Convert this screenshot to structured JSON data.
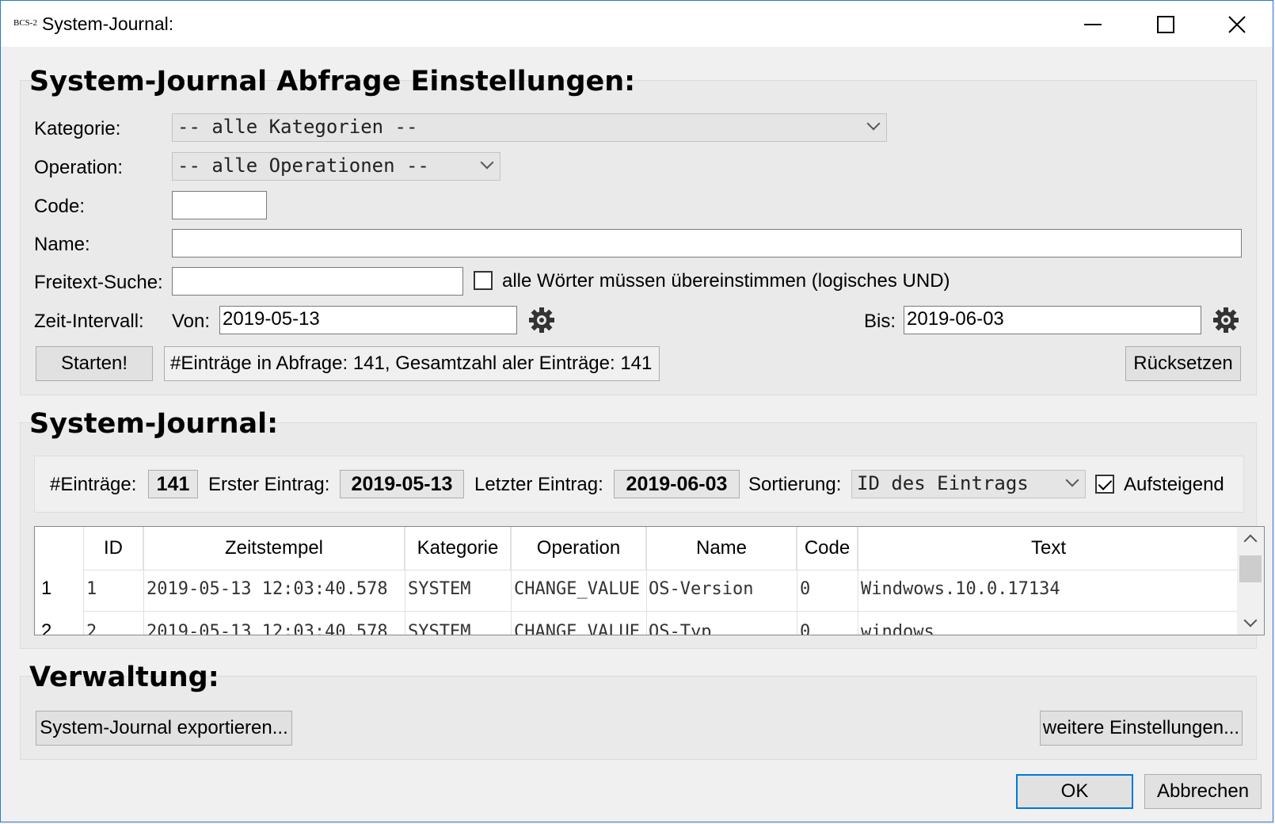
{
  "window": {
    "logo": "BCS-2",
    "title": "System-Journal:"
  },
  "query": {
    "title": "System-Journal Abfrage Einstellungen:",
    "category_label": "Kategorie:",
    "category_value": "-- alle Kategorien --",
    "operation_label": "Operation:",
    "operation_value": "-- alle Operationen --",
    "code_label": "Code:",
    "code_value": "",
    "name_label": "Name:",
    "name_value": "",
    "search_label": "Freitext-Suche:",
    "search_value": "",
    "all_words_label": "alle Wörter müssen übereinstimmen (logisches UND)",
    "all_words_checked": false,
    "interval_label": "Zeit-Intervall:",
    "from_label": "Von:",
    "from_value": "2019-05-13",
    "to_label": "Bis:",
    "to_value": "2019-06-03",
    "start_button": "Starten!",
    "status_text": "#Einträge in Abfrage: 141, Gesamtzahl aler Einträge: 141",
    "reset_button": "Rücksetzen"
  },
  "journal": {
    "title": "System-Journal:",
    "entries_label": "#Einträge:",
    "entries_value": "141",
    "first_label": "Erster Eintrag:",
    "first_value": "2019-05-13",
    "last_label": "Letzter Eintrag:",
    "last_value": "2019-06-03",
    "sort_label": "Sortierung:",
    "sort_value": "ID des Eintrags",
    "ascending_label": "Aufsteigend",
    "ascending_checked": true,
    "columns": [
      "ID",
      "Zeitstempel",
      "Kategorie",
      "Operation",
      "Name",
      "Code",
      "Text"
    ],
    "rows": [
      {
        "num": "1",
        "id": "1",
        "timestamp": "2019-05-13 12:03:40.578",
        "category": "SYSTEM",
        "operation": "CHANGE_VALUE",
        "name": "OS-Version",
        "code": "0",
        "text": "Windwows.10.0.17134"
      },
      {
        "num": "2",
        "id": "2",
        "timestamp": "2019-05-13 12:03:40.578",
        "category": "SYSTEM",
        "operation": "CHANGE_VALUE",
        "name": "OS-Typ",
        "code": "0",
        "text": "windows"
      }
    ]
  },
  "admin": {
    "title": "Verwaltung:",
    "export_button": "System-Journal exportieren...",
    "more_settings_button": "weitere Einstellungen..."
  },
  "dialog": {
    "ok_button": "OK",
    "cancel_button": "Abbrechen"
  }
}
